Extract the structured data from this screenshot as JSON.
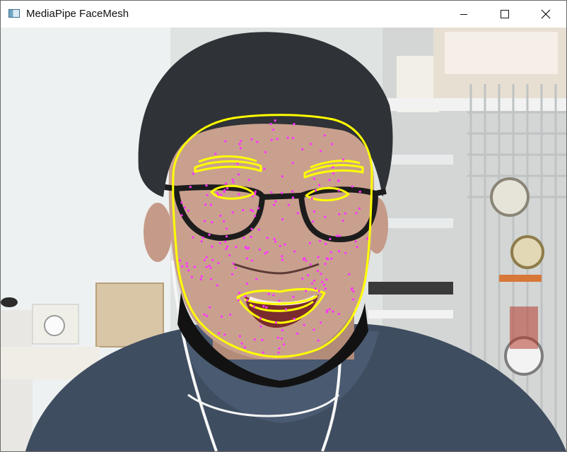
{
  "window": {
    "title": "MediaPipe FaceMesh",
    "app_icon": "window-app-icon",
    "controls": [
      {
        "name": "minimize",
        "icon": "minimize-icon"
      },
      {
        "name": "maximize",
        "icon": "maximize-icon"
      },
      {
        "name": "close",
        "icon": "close-icon"
      }
    ]
  },
  "overlay": {
    "landmark_color": "#ff33ff",
    "contour_color": "#ffff00"
  }
}
